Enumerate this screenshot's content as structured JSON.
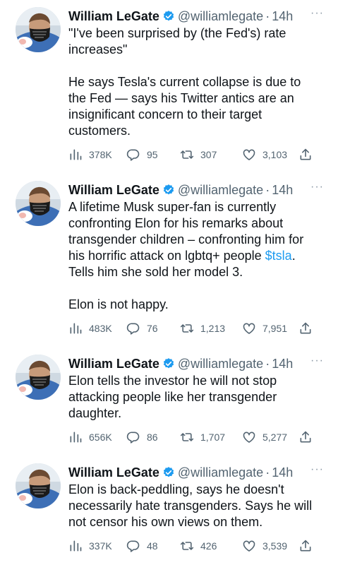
{
  "tweets": [
    {
      "author": "William LeGate",
      "handle": "@williamlegate",
      "separator": "·",
      "time": "14h",
      "lines_a": [
        "\"I've been surprised by (the Fed's) rate",
        "increases\""
      ],
      "lines_b": [
        "He says Tesla's current collapse is due to",
        "the Fed — says his Twitter antics are an",
        "insignificant concern to their target",
        "customers."
      ],
      "views": "378K",
      "replies": "95",
      "retweets": "307",
      "likes": "3,103"
    },
    {
      "author": "William LeGate",
      "handle": "@williamlegate",
      "separator": "·",
      "time": "14h",
      "lines_a": [
        "A lifetime Musk super-fan is currently",
        "confronting Elon for his remarks about",
        "transgender children – confronting him for"
      ],
      "line_cash_pre": "his horrific attack on lgbtq+ people ",
      "cashtag": "$tsla",
      "line_cash_post": ".",
      "lines_c": [
        "Tells him she sold her model 3."
      ],
      "lines_b": [
        "Elon is not happy."
      ],
      "views": "483K",
      "replies": "76",
      "retweets": "1,213",
      "likes": "7,951"
    },
    {
      "author": "William LeGate",
      "handle": "@williamlegate",
      "separator": "·",
      "time": "14h",
      "lines_a": [
        "Elon tells the investor he will not stop",
        "attacking people like her transgender",
        "daughter."
      ],
      "views": "656K",
      "replies": "86",
      "retweets": "1,707",
      "likes": "5,277"
    },
    {
      "author": "William LeGate",
      "handle": "@williamlegate",
      "separator": "·",
      "time": "14h",
      "lines_a": [
        "Elon is back-peddling, says he doesn't",
        "necessarily hate transgenders. Says he will",
        "not censor his own views on them."
      ],
      "views": "337K",
      "replies": "48",
      "retweets": "426",
      "likes": "3,539"
    }
  ],
  "icons": {
    "views": "views-icon",
    "reply": "reply-icon",
    "retweet": "retweet-icon",
    "like": "like-icon",
    "share": "share-icon",
    "verified": "verified-badge-icon",
    "more": "more-icon"
  },
  "colors": {
    "text": "#0f1419",
    "secondary": "#536471",
    "link": "#1d9bf0",
    "verified": "#1d9bf0"
  }
}
